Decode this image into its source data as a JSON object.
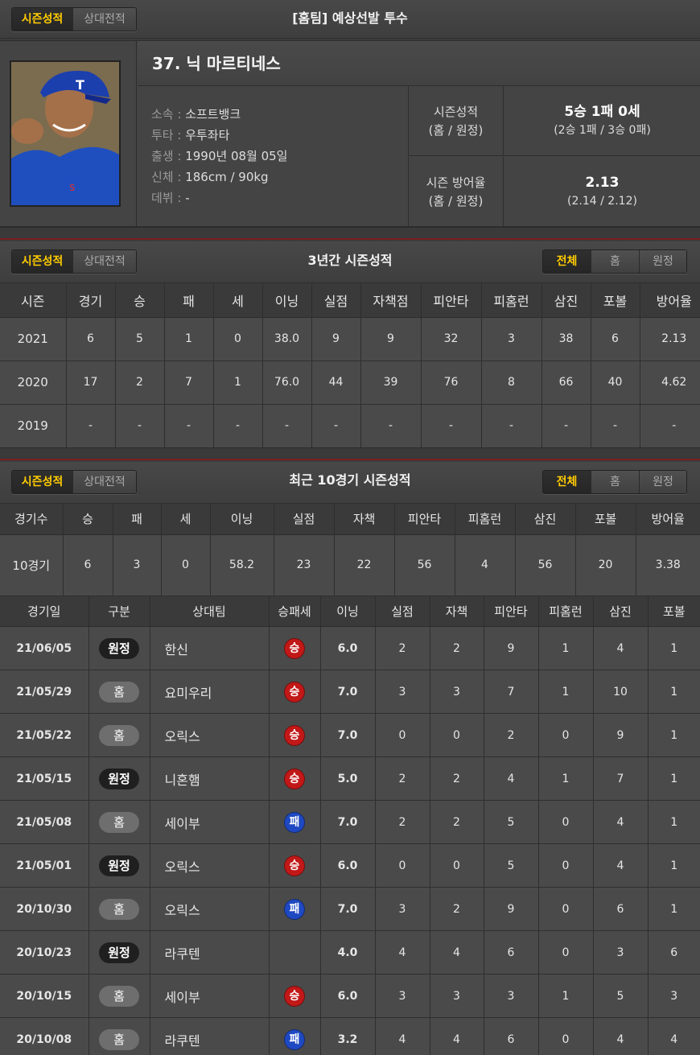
{
  "top": {
    "tabs": [
      "시즌성적",
      "상대전적"
    ],
    "title": "[홈팀] 예상선발 투수"
  },
  "player": {
    "name": "37. 닉 마르티네스",
    "info": [
      {
        "label": "소속",
        "value": "소프트뱅크"
      },
      {
        "label": "투타",
        "value": "우투좌타"
      },
      {
        "label": "출생",
        "value": "1990년 08월 05일"
      },
      {
        "label": "신체",
        "value": "186cm / 90kg"
      },
      {
        "label": "데뷔",
        "value": "-"
      }
    ],
    "record_label_1": "시즌성적",
    "record_label_2": "(홈 / 원정)",
    "record_main": "5승 1패 0세",
    "record_sub": "(2승 1패 / 3승 0패)",
    "era_label_1": "시즌 방어율",
    "era_label_2": "(홈 / 원정)",
    "era_main": "2.13",
    "era_sub": "(2.14 / 2.12)"
  },
  "season": {
    "tabs": [
      "시즌성적",
      "상대전적"
    ],
    "title": "3년간 시즌성적",
    "filters": [
      "전체",
      "홈",
      "원정"
    ],
    "headers": [
      "시즌",
      "경기",
      "승",
      "패",
      "세",
      "이닝",
      "실점",
      "자책점",
      "피안타",
      "피홈런",
      "삼진",
      "포볼",
      "방어율"
    ],
    "rows": [
      [
        "2021",
        "6",
        "5",
        "1",
        "0",
        "38.0",
        "9",
        "9",
        "32",
        "3",
        "38",
        "6",
        "2.13"
      ],
      [
        "2020",
        "17",
        "2",
        "7",
        "1",
        "76.0",
        "44",
        "39",
        "76",
        "8",
        "66",
        "40",
        "4.62"
      ],
      [
        "2019",
        "-",
        "-",
        "-",
        "-",
        "-",
        "-",
        "-",
        "-",
        "-",
        "-",
        "-",
        "-"
      ]
    ]
  },
  "recent": {
    "tabs": [
      "시즌성적",
      "상대전적"
    ],
    "title": "최근 10경기 시즌성적",
    "filters": [
      "전체",
      "홈",
      "원정"
    ],
    "summary_headers": [
      "경기수",
      "승",
      "패",
      "세",
      "이닝",
      "실점",
      "자책",
      "피안타",
      "피홈런",
      "삼진",
      "포볼",
      "방어율"
    ],
    "summary": [
      "10경기",
      "6",
      "3",
      "0",
      "58.2",
      "23",
      "22",
      "56",
      "4",
      "56",
      "20",
      "3.38"
    ],
    "game_headers": [
      "경기일",
      "구분",
      "상대팀",
      "승패세",
      "이닝",
      "실점",
      "자책",
      "피안타",
      "피홈런",
      "삼진",
      "포볼"
    ],
    "games": [
      {
        "date": "21/06/05",
        "venue": "원정",
        "opp": "한신",
        "res": "승",
        "ip": "6.0",
        "r": "2",
        "er": "2",
        "h": "9",
        "hr": "1",
        "so": "4",
        "bb": "1"
      },
      {
        "date": "21/05/29",
        "venue": "홈",
        "opp": "요미우리",
        "res": "승",
        "ip": "7.0",
        "r": "3",
        "er": "3",
        "h": "7",
        "hr": "1",
        "so": "10",
        "bb": "1"
      },
      {
        "date": "21/05/22",
        "venue": "홈",
        "opp": "오릭스",
        "res": "승",
        "ip": "7.0",
        "r": "0",
        "er": "0",
        "h": "2",
        "hr": "0",
        "so": "9",
        "bb": "1"
      },
      {
        "date": "21/05/15",
        "venue": "원정",
        "opp": "니혼햄",
        "res": "승",
        "ip": "5.0",
        "r": "2",
        "er": "2",
        "h": "4",
        "hr": "1",
        "so": "7",
        "bb": "1"
      },
      {
        "date": "21/05/08",
        "venue": "홈",
        "opp": "세이부",
        "res": "패",
        "ip": "7.0",
        "r": "2",
        "er": "2",
        "h": "5",
        "hr": "0",
        "so": "4",
        "bb": "1"
      },
      {
        "date": "21/05/01",
        "venue": "원정",
        "opp": "오릭스",
        "res": "승",
        "ip": "6.0",
        "r": "0",
        "er": "0",
        "h": "5",
        "hr": "0",
        "so": "4",
        "bb": "1"
      },
      {
        "date": "20/10/30",
        "venue": "홈",
        "opp": "오릭스",
        "res": "패",
        "ip": "7.0",
        "r": "3",
        "er": "2",
        "h": "9",
        "hr": "0",
        "so": "6",
        "bb": "1"
      },
      {
        "date": "20/10/23",
        "venue": "원정",
        "opp": "라쿠텐",
        "res": "",
        "ip": "4.0",
        "r": "4",
        "er": "4",
        "h": "6",
        "hr": "0",
        "so": "3",
        "bb": "6"
      },
      {
        "date": "20/10/15",
        "venue": "홈",
        "opp": "세이부",
        "res": "승",
        "ip": "6.0",
        "r": "3",
        "er": "3",
        "h": "3",
        "hr": "1",
        "so": "5",
        "bb": "3"
      },
      {
        "date": "20/10/08",
        "venue": "홈",
        "opp": "라쿠텐",
        "res": "패",
        "ip": "3.2",
        "r": "4",
        "er": "4",
        "h": "6",
        "hr": "0",
        "so": "4",
        "bb": "4"
      }
    ]
  },
  "colors": {
    "accent": "#ffcc00",
    "win": "#c21818",
    "loss": "#1f49c2",
    "divider": "#7a1f1f"
  }
}
